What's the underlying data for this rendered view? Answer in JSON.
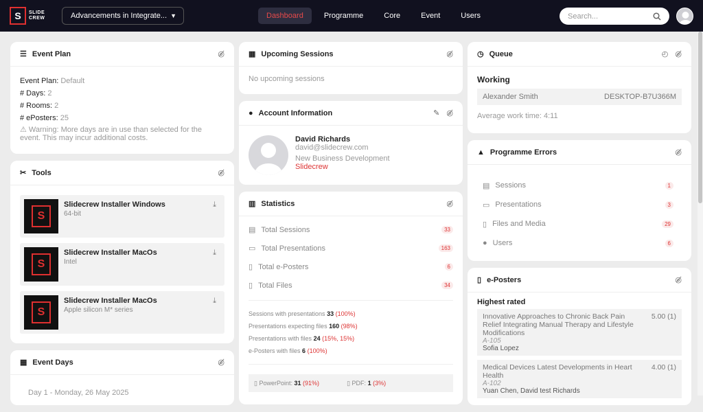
{
  "brand": {
    "line1": "SLIDE",
    "line2": "CREW",
    "mark": "S"
  },
  "event_select": {
    "value": "Advancements in Integrate...",
    "caret": "▼"
  },
  "nav": [
    "Dashboard",
    "Programme",
    "Core",
    "Event",
    "Users"
  ],
  "search": {
    "placeholder": "Search...",
    "icon": "search-icon"
  },
  "event_plan": {
    "title": "Event Plan",
    "plan_label": "Event Plan:",
    "plan_value": "Default",
    "days_label": "# Days:",
    "days_value": "2",
    "rooms_label": "# Rooms:",
    "rooms_value": "2",
    "eposters_label": "# ePosters:",
    "eposters_value": "25",
    "warning": "⚠ Warning: More days are in use than selected for the event. This may incur additional costs."
  },
  "tools": {
    "title": "Tools",
    "items": [
      {
        "name": "Slidecrew Installer Windows",
        "sub": "64-bit"
      },
      {
        "name": "Slidecrew Installer MacOs",
        "sub": "Intel"
      },
      {
        "name": "Slidecrew Installer MacOs",
        "sub": "Apple silicon M* series"
      }
    ]
  },
  "event_days": {
    "title": "Event Days",
    "first": "Day 1 - Monday, 26 May 2025"
  },
  "upcoming": {
    "title": "Upcoming Sessions",
    "empty": "No upcoming sessions"
  },
  "account": {
    "title": "Account Information",
    "name": "David Richards",
    "email": "david@slidecrew.com",
    "role": "New Business Development",
    "company": "Slidecrew"
  },
  "statistics": {
    "title": "Statistics",
    "rows": [
      {
        "label": "Total Sessions",
        "value": "33"
      },
      {
        "label": "Total Presentations",
        "value": "163"
      },
      {
        "label": "Total e-Posters",
        "value": "6"
      },
      {
        "label": "Total Files",
        "value": "34"
      }
    ],
    "details": [
      {
        "label": "Sessions with presentations",
        "num": "33",
        "pct": "(100%)"
      },
      {
        "label": "Presentations expecting files",
        "num": "160",
        "pct": "(98%)"
      },
      {
        "label": "Presentations with files",
        "num": "24",
        "pct": "(15%, 15%)"
      },
      {
        "label": "e-Posters with files",
        "num": "6",
        "pct": "(100%)"
      }
    ],
    "files": [
      {
        "label": "PowerPoint:",
        "num": "31",
        "pct": "(91%)"
      },
      {
        "label": "PDF:",
        "num": "1",
        "pct": "(3%)"
      }
    ]
  },
  "queue": {
    "title": "Queue",
    "status": "Working",
    "user": "Alexander Smith",
    "machine": "DESKTOP-B7U366M",
    "avg": "Average work time: 4:11"
  },
  "programme_errors": {
    "title": "Programme Errors",
    "rows": [
      {
        "label": "Sessions",
        "value": "1"
      },
      {
        "label": "Presentations",
        "value": "3"
      },
      {
        "label": "Files and Media",
        "value": "29"
      },
      {
        "label": "Users",
        "value": "6"
      }
    ]
  },
  "eposters": {
    "title": "e-Posters",
    "subtitle": "Highest rated",
    "items": [
      {
        "title": "Innovative Approaches to Chronic Back Pain Relief Integrating Manual Therapy and Lifestyle Modifications",
        "score": "5.00 (1)",
        "code": "A-105",
        "author": "Sofia Lopez"
      },
      {
        "title": "Medical Devices Latest Developments in Heart Health",
        "score": "4.00 (1)",
        "code": "A-102",
        "author": "Yuan Chen, David test Richards"
      }
    ]
  }
}
